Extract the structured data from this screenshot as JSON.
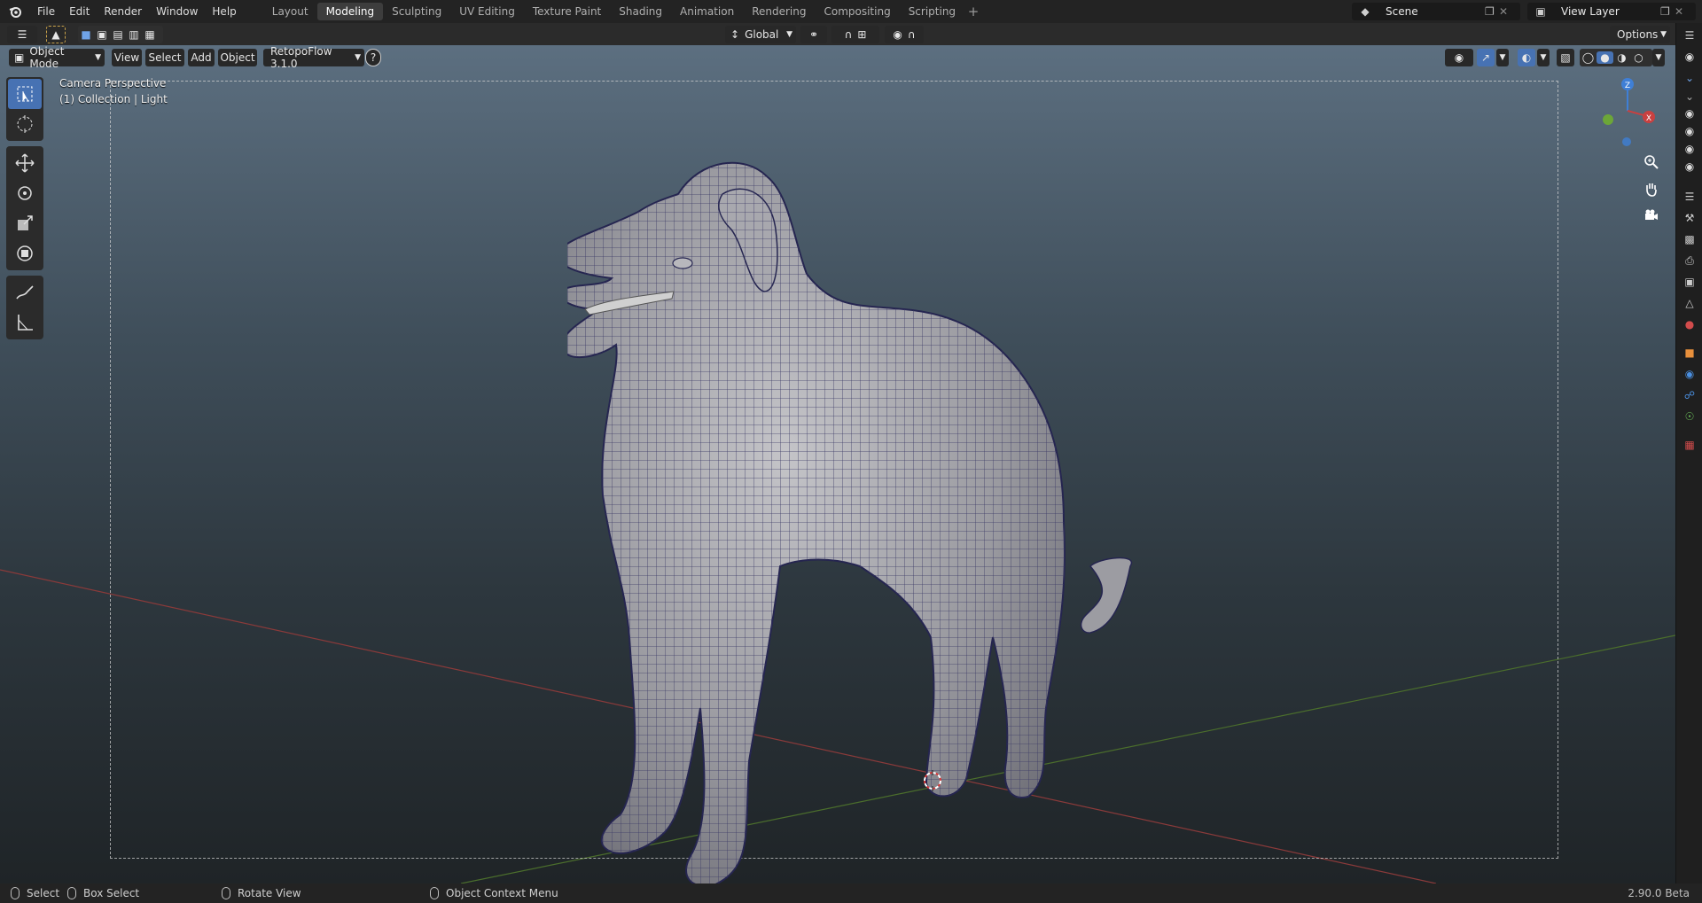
{
  "topbar": {
    "menus": [
      "File",
      "Edit",
      "Render",
      "Window",
      "Help"
    ],
    "workspaces": [
      "Layout",
      "Modeling",
      "Sculpting",
      "UV Editing",
      "Texture Paint",
      "Shading",
      "Animation",
      "Rendering",
      "Compositing",
      "Scripting"
    ],
    "active_workspace": "Modeling",
    "scene": "Scene",
    "view_layer": "View Layer"
  },
  "tool_settings": {
    "orientation": "Global",
    "options_label": "Options"
  },
  "viewport_header": {
    "mode": "Object Mode",
    "menus": [
      "View",
      "Select",
      "Add",
      "Object"
    ],
    "addon": "RetopoFlow 3.1.0"
  },
  "viewport": {
    "perspective_label": "Camera Perspective",
    "collection_label": "(1) Collection | Light",
    "gizmo_axis_z": "Z",
    "gizmo_axis_x": "X",
    "axis_colors": {
      "x": "#c94040",
      "y": "#6ca638",
      "z": "#3f7fd6"
    },
    "accent": "#4772b3"
  },
  "statusbar": {
    "select": "Select",
    "box_select": "Box Select",
    "rotate_view": "Rotate View",
    "context_menu": "Object Context Menu",
    "version": "2.90.0 Beta"
  }
}
